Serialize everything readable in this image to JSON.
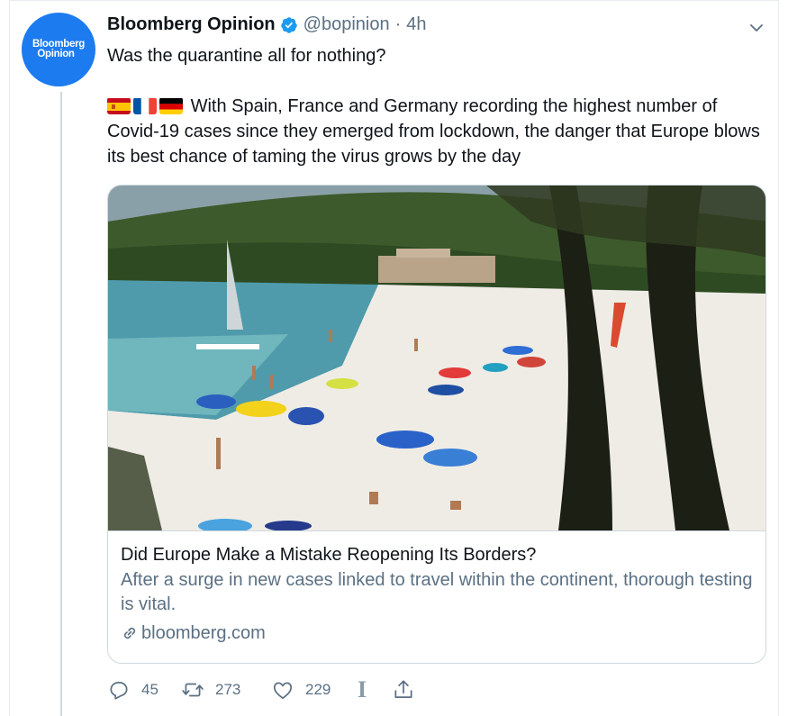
{
  "tweet": {
    "author_name": "Bloomberg Opinion",
    "author_handle": "@bopinion",
    "separator": "·",
    "time": "4h",
    "avatar_line1": "Bloomberg",
    "avatar_line2": "Opinion",
    "text_line1": "Was the quarantine all for nothing?",
    "flags": [
      "spain-flag",
      "france-flag",
      "germany-flag"
    ],
    "text_para": "With Spain, France and Germany recording the highest number of Covid-19 cases since they emerged from lockdown, the danger that Europe blows its best chance of taming the virus grows by the day"
  },
  "card": {
    "title": "Did Europe Make a Mistake Reopening Its Borders?",
    "description": "After a surge in new cases linked to travel within the continent, thorough testing is vital.",
    "domain": "bloomberg.com",
    "image_subject": "crowded beach with umbrellas and pine trees"
  },
  "actions": {
    "reply_count": "45",
    "retweet_count": "273",
    "like_count": "229",
    "extension_glyph": "I"
  },
  "colors": {
    "brand_blue": "#1d7bf0",
    "secondary_text": "#5b7083",
    "border": "#cfd9de"
  }
}
